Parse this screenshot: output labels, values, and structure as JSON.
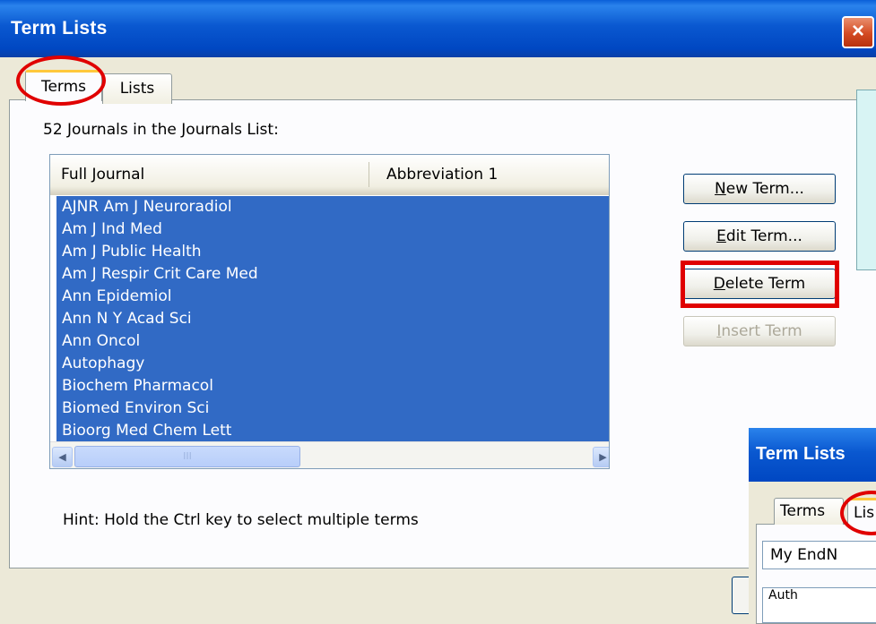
{
  "window": {
    "title": "Term Lists",
    "close_label": "×"
  },
  "tabs": [
    {
      "label": "Terms"
    },
    {
      "label": "Lists"
    }
  ],
  "list": {
    "count_label": "52 Journals in the Journals List:",
    "columns": [
      "Full Journal",
      "Abbreviation 1"
    ],
    "rows": [
      "AJNR Am J Neuroradiol",
      "Am J Ind Med",
      "Am J Public Health",
      "Am J Respir Crit Care Med",
      "Ann Epidemiol",
      "Ann N Y Acad Sci",
      "Ann Oncol",
      "Autophagy",
      "Biochem Pharmacol",
      "Biomed Environ Sci",
      "Bioorg Med Chem Lett"
    ],
    "scroll": {
      "up": "▲",
      "down": "▼",
      "left": "◀",
      "right": "▶",
      "grip": "III"
    }
  },
  "buttons": {
    "new_term": "New Term...",
    "edit_term": "Edit Term...",
    "delete_term": "Delete Term",
    "insert_term": "Insert Term"
  },
  "hint": "Hint: Hold the Ctrl key to select multiple terms",
  "overlay": {
    "title": "Term Lists",
    "tab_terms": "Terms",
    "tab_lists": "Lis",
    "field_text": "My EndN",
    "field2_text": "Auth"
  },
  "colors": {
    "selection": "#316ac5",
    "highlight_red": "#e00000",
    "title_blue": "#0047c2"
  }
}
